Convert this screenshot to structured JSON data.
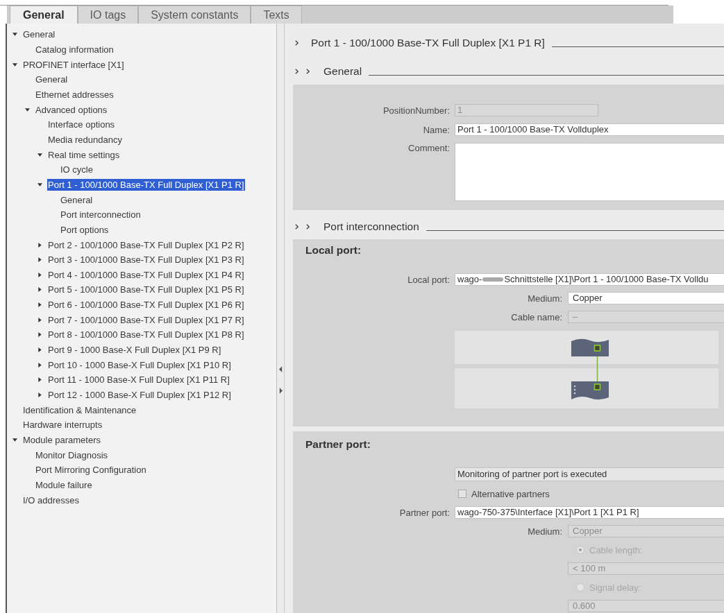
{
  "tabs": [
    {
      "label": "General",
      "selected": true
    },
    {
      "label": "IO tags",
      "selected": false
    },
    {
      "label": "System constants",
      "selected": false
    },
    {
      "label": "Texts",
      "selected": false
    }
  ],
  "tree": {
    "items": [
      {
        "label": "General",
        "expanded": true,
        "selected": false,
        "children": [
          {
            "label": "Catalog information",
            "selected": false
          }
        ]
      },
      {
        "label": "PROFINET interface [X1]",
        "expanded": true,
        "selected": false,
        "children": [
          {
            "label": "General",
            "selected": false
          },
          {
            "label": "Ethernet addresses",
            "selected": false
          },
          {
            "label": "Advanced options",
            "expanded": true,
            "selected": false,
            "children": [
              {
                "label": "Interface options",
                "selected": false
              },
              {
                "label": "Media redundancy",
                "selected": false
              },
              {
                "label": "Real time settings",
                "expanded": true,
                "selected": false,
                "children": [
                  {
                    "label": "IO cycle",
                    "selected": false
                  }
                ]
              },
              {
                "label": "Port 1 - 100/1000 Base-TX Full Duplex [X1 P1 R]",
                "expanded": true,
                "selected": true,
                "children": [
                  {
                    "label": "General",
                    "selected": false
                  },
                  {
                    "label": "Port interconnection",
                    "selected": false
                  },
                  {
                    "label": "Port options",
                    "selected": false
                  }
                ]
              },
              {
                "label": "Port 2 - 100/1000 Base-TX Full Duplex [X1 P2 R]",
                "expanded": false,
                "selected": false
              },
              {
                "label": "Port 3 - 100/1000 Base-TX Full Duplex [X1 P3 R]",
                "expanded": false,
                "selected": false
              },
              {
                "label": "Port 4 - 100/1000 Base-TX Full Duplex [X1 P4 R]",
                "expanded": false,
                "selected": false
              },
              {
                "label": "Port 5 - 100/1000 Base-TX Full Duplex [X1 P5 R]",
                "expanded": false,
                "selected": false
              },
              {
                "label": "Port 6 - 100/1000 Base-TX Full Duplex [X1 P6 R]",
                "expanded": false,
                "selected": false
              },
              {
                "label": "Port 7 - 100/1000 Base-TX Full Duplex [X1 P7 R]",
                "expanded": false,
                "selected": false
              },
              {
                "label": "Port 8 - 100/1000 Base-TX Full Duplex [X1 P8 R]",
                "expanded": false,
                "selected": false
              },
              {
                "label": "Port 9 - 1000 Base-X Full Duplex [X1 P9 R]",
                "expanded": false,
                "selected": false
              },
              {
                "label": "Port 10 - 1000 Base-X Full Duplex [X1 P10 R]",
                "expanded": false,
                "selected": false
              },
              {
                "label": "Port 11 - 1000 Base-X Full Duplex [X1 P11 R]",
                "expanded": false,
                "selected": false
              },
              {
                "label": "Port 12 - 1000 Base-X Full Duplex [X1 P12 R]",
                "expanded": false,
                "selected": false
              }
            ]
          }
        ]
      },
      {
        "label": "Identification & Maintenance",
        "selected": false
      },
      {
        "label": "Hardware interrupts",
        "selected": false
      },
      {
        "label": "Module parameters",
        "expanded": true,
        "selected": false,
        "children": [
          {
            "label": "Monitor Diagnosis",
            "selected": false
          },
          {
            "label": "Port Mirroring Configuration",
            "selected": false
          },
          {
            "label": "Module failure",
            "selected": false
          }
        ]
      },
      {
        "label": "I/O addresses",
        "selected": false
      }
    ]
  },
  "properties": {
    "title": "Port 1 - 100/1000 Base-TX Full Duplex [X1 P1 R]",
    "sections": [
      {
        "title": "General",
        "groups": [
          {
            "fields": [
              {
                "kind": "number",
                "label": "PositionNumber:",
                "value": "1",
                "disabled": true
              },
              {
                "kind": "text",
                "label": "Name:",
                "value": "Port 1 - 100/1000 Base-TX Vollduplex",
                "disabled": false
              },
              {
                "kind": "textarea",
                "label": "Comment:",
                "disabled": false
              }
            ]
          }
        ]
      },
      {
        "title": "Port interconnection",
        "groups": [
          {
            "title": "Local port:",
            "fields": [
              {
                "kind": "text",
                "label": "Local port:",
                "value": "wago-",
                "redacted": true,
                "value_tail": "Schnittstelle [X1]\\Port 1 - 100/1000 Base-TX Volldu",
                "disabled": false
              },
              {
                "kind": "subfield",
                "label": "Medium:",
                "value": "Copper",
                "disabled": false
              },
              {
                "kind": "subfield",
                "label": "Cable name:",
                "value": "–",
                "disabled": true
              },
              {
                "kind": "topology"
              }
            ]
          },
          {
            "title": "Partner port:",
            "fields": [
              {
                "kind": "select",
                "value": "Monitoring of partner port is executed",
                "disabled": false
              },
              {
                "kind": "checkbox",
                "label": "Alternative partners",
                "checked": false,
                "disabled": false
              },
              {
                "kind": "text",
                "label": "Partner port:",
                "value": "wago-750-375\\Interface [X1]\\Port 1 [X1 P1 R]",
                "disabled": false
              },
              {
                "kind": "subfield",
                "label": "Medium:",
                "value": "Copper",
                "disabled": true
              },
              {
                "kind": "radio",
                "label": "Cable length:",
                "selected": true,
                "disabled": true
              },
              {
                "kind": "subfield",
                "value": "< 100 m",
                "disabled": true
              },
              {
                "kind": "radio",
                "label": "Signal delay:",
                "selected": false,
                "disabled": true
              },
              {
                "kind": "subfield",
                "value": "0.600",
                "disabled": true
              }
            ]
          }
        ]
      }
    ]
  }
}
